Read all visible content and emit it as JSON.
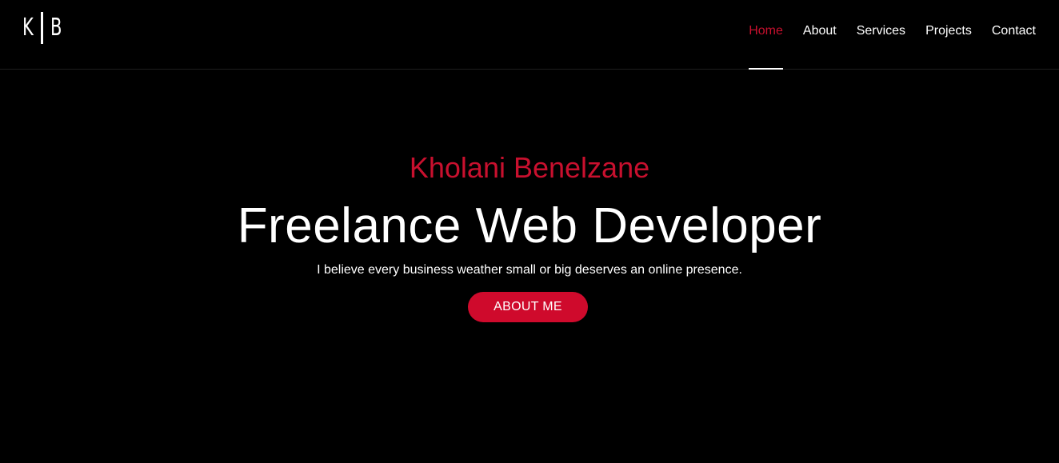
{
  "brand": {
    "logo_left": "K",
    "logo_right": "B"
  },
  "nav": {
    "items": [
      {
        "label": "Home",
        "active": true
      },
      {
        "label": "About",
        "active": false
      },
      {
        "label": "Services",
        "active": false
      },
      {
        "label": "Projects",
        "active": false
      },
      {
        "label": "Contact",
        "active": false
      }
    ]
  },
  "hero": {
    "name": "Kholani Benelzane",
    "title": "Freelance Web Developer",
    "tagline": "I believe every business weather small or big deserves an online presence.",
    "button_label": "ABOUT ME"
  },
  "colors": {
    "background": "#000000",
    "accent": "#c8102e",
    "text": "#ffffff"
  }
}
